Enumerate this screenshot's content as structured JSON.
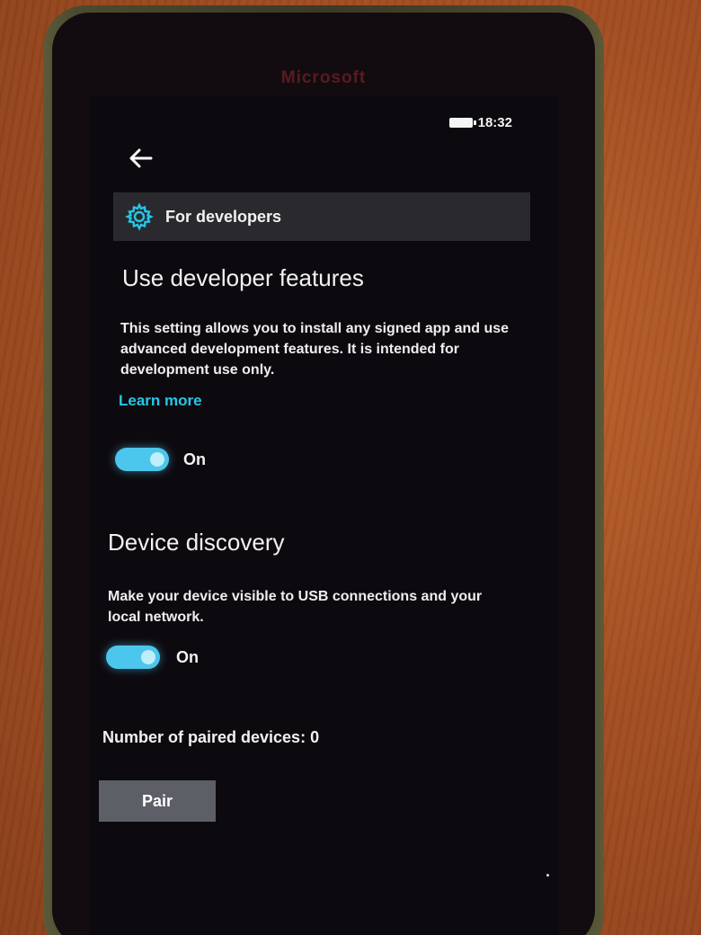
{
  "device": {
    "brand": "Microsoft"
  },
  "status_bar": {
    "time": "18:32",
    "battery_icon": "battery-full-icon"
  },
  "header": {
    "back_icon": "back-arrow-icon",
    "settings_icon": "gear-icon",
    "title": "For developers"
  },
  "developer_features": {
    "title": "Use developer features",
    "description": "This setting allows you to install any signed app and use advanced development features. It is intended for development use only.",
    "link_label": "Learn more",
    "toggle_state": "On",
    "toggle_on": true
  },
  "device_discovery": {
    "title": "Device discovery",
    "description": "Make your device visible to USB connections and your local network.",
    "toggle_state": "On",
    "toggle_on": true,
    "paired_devices_label": "Number of paired devices: 0",
    "pair_button": "Pair"
  },
  "colors": {
    "accent": "#25c7e8",
    "toggle_fill": "#4cc6ec",
    "screen_background": "#0d0a0f",
    "header_bar": "#2a2a2e",
    "button": "#5c5f66"
  }
}
